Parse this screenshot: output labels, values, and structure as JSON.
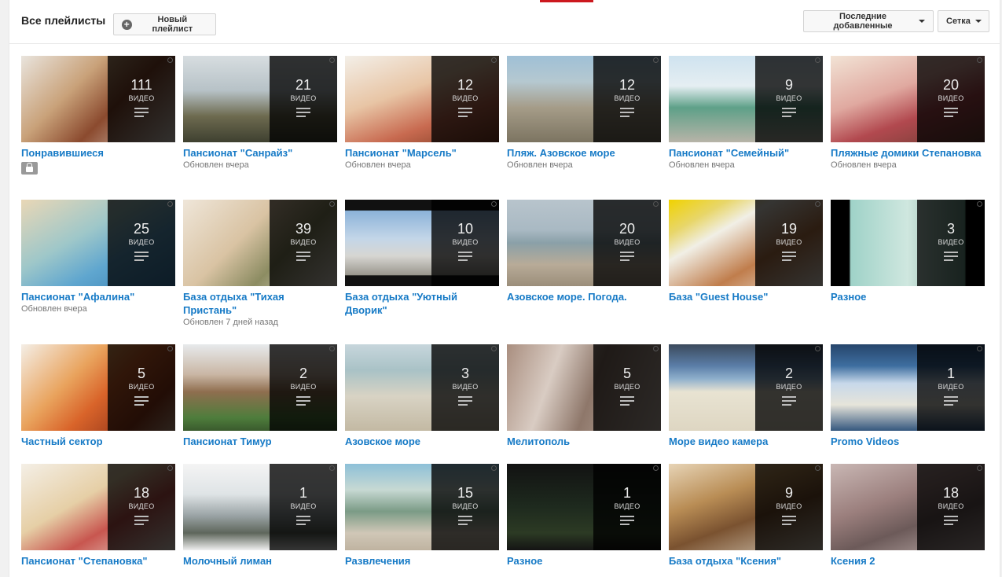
{
  "header": {
    "title": "Все плейлисты",
    "new_playlist_label": "Новый плейлист",
    "sort_label": "Последние добавленные",
    "view_label": "Сетка"
  },
  "count_label": "ВИДЕО",
  "colors": {
    "link": "#167ac6",
    "accent": "#cc181e"
  },
  "playlists": [
    {
      "title": "Понравившиеся",
      "count": "111",
      "meta": "",
      "private": true,
      "bg": "linear-gradient(135deg,#e9e4dd 0%,#c9a27a 35%,#8b4a2e 60%,#e2dcd3 100%)"
    },
    {
      "title": "Пансионат \"Санрайз\"",
      "count": "21",
      "meta": "Обновлен вчера",
      "private": false,
      "bg": "linear-gradient(180deg,#d7dde0 0%,#b7c2c7 40%,#6d6a4f 70%,#3e4030 100%)"
    },
    {
      "title": "Пансионат \"Марсель\"",
      "count": "12",
      "meta": "Обновлен вчера",
      "private": false,
      "bg": "linear-gradient(160deg,#f3efe8 0%,#e8c5a5 40%,#c86a50 70%,#7b3a22 100%)"
    },
    {
      "title": "Пляж. Азовское море",
      "count": "12",
      "meta": "Обновлен вчера",
      "private": false,
      "bg": "linear-gradient(180deg,#9fc0d6 0%,#b5c8d0 30%,#a59c88 60%,#7c7461 100%)"
    },
    {
      "title": "Пансионат \"Семейный\"",
      "count": "9",
      "meta": "Обновлен вчера",
      "private": false,
      "bg": "linear-gradient(180deg,#cfe3ef 0%,#e5eef2 35%,#5ea088 60%,#b8b4a8 100%)"
    },
    {
      "title": "Пляжные домики Степановка",
      "count": "20",
      "meta": "Обновлен вчера",
      "private": false,
      "bg": "linear-gradient(160deg,#f2e3d5 0%,#e0a9a0 40%,#b2494f 65%,#6b3d33 100%)"
    },
    {
      "title": "Пансионат \"Афалина\"",
      "count": "25",
      "meta": "Обновлен вчера",
      "private": false,
      "bg": "linear-gradient(150deg,#e9d7b6 0%,#9ec7c9 40%,#5fa6cf 65%,#3a7fb2 100%)"
    },
    {
      "title": "База отдыха \"Тихая Пристань\"",
      "count": "39",
      "meta": "Обновлен 7 дней назад",
      "private": false,
      "bg": "linear-gradient(135deg,#efe6d9 0%,#d9c3a3 40%,#8c8c62 65%,#e9e2d8 100%)"
    },
    {
      "title": "База отдыха \"Уютный Дворик\"",
      "count": "10",
      "meta": "",
      "private": false,
      "bg": "linear-gradient(180deg,#111 0%,#111 12%,#8cb3d9 13%,#c3d6e8 45%,#d7d6d2 65%,#9a978e 87%,#111 88%,#111 100%)"
    },
    {
      "title": "Азовское море. Погода.",
      "count": "20",
      "meta": "",
      "private": false,
      "bg": "linear-gradient(180deg,#b8c4cc 0%,#a9b9c3 35%,#8aa0a8 50%,#b8ab98 75%,#9b8e7a 100%)"
    },
    {
      "title": "База \"Guest House\"",
      "count": "19",
      "meta": "",
      "private": false,
      "bg": "linear-gradient(150deg,#f0d200 0%,#e8d66a 20%,#f1efe6 35%,#c07d4c 65%,#ede8de 100%)"
    },
    {
      "title": "Разное",
      "count": "3",
      "meta": "",
      "private": false,
      "bg": "linear-gradient(90deg,#000 0%,#000 12%,#9fd2c8 13%,#cfe7df 50%,#6e9d8d 87%,#000 88%,#000 100%)"
    },
    {
      "title": "Частный сектор",
      "count": "5",
      "meta": "",
      "private": false,
      "bg": "linear-gradient(135deg,#f4eee6 0%,#e9a35d 35%,#d9642a 55%,#9b3b1c 80%,#c79d82 100%)"
    },
    {
      "title": "Пансионат Тимур",
      "count": "2",
      "meta": "",
      "private": false,
      "bg": "linear-gradient(180deg,#e7eaec 0%,#c9b6a4 35%,#8f6e4f 55%,#4e7d3c 85%,#3a5a2d 100%)"
    },
    {
      "title": "Азовское море",
      "count": "3",
      "meta": "",
      "private": false,
      "bg": "linear-gradient(180deg,#c7d6dc 0%,#a9c2c6 30%,#d8d3c4 60%,#c3b9a3 100%)"
    },
    {
      "title": "Мелитополь",
      "count": "5",
      "meta": "",
      "private": false,
      "bg": "linear-gradient(110deg,#a98e7f 0%,#d9ccc3 30%,#8e776a 55%,#c8b9ae 100%)"
    },
    {
      "title": "Море видео камера",
      "count": "2",
      "meta": "",
      "private": false,
      "bg": "linear-gradient(180deg,#3b4a5c 0%,#5b7ea8 25%,#8fb0cc 40%,#e8e3d2 55%,#ded6c2 100%)"
    },
    {
      "title": "Promo Videos",
      "count": "1",
      "meta": "",
      "private": false,
      "bg": "linear-gradient(180deg,#26456b 0%,#3e6ea0 25%,#c7d8ea 45%,#e6e4da 70%,#35577e 100%)"
    },
    {
      "title": "Пансионат \"Степановка\"",
      "count": "18",
      "meta": "",
      "private": false,
      "bg": "linear-gradient(150deg,#f4efe6 0%,#e6cfa6 40%,#c8564f 65%,#e9dfd4 100%)"
    },
    {
      "title": "Молочный лиман",
      "count": "1",
      "meta": "",
      "private": false,
      "bg": "linear-gradient(180deg,#f4f4f4 0%,#dfe4e6 35%,#9aa3a5 60%,#5e665b 80%,#efefef 100%)"
    },
    {
      "title": "Развлечения",
      "count": "15",
      "meta": "",
      "private": false,
      "bg": "linear-gradient(180deg,#8dc0d8 0%,#c7d9d3 30%,#7b9b86 55%,#d0c7b7 80%,#bfb3a0 100%)"
    },
    {
      "title": "Разное",
      "count": "1",
      "meta": "",
      "private": false,
      "bg": "linear-gradient(180deg,#121212 0%,#1e2a1e 50%,#2c3a24 80%,#141414 100%)"
    },
    {
      "title": "База отдыха \"Ксения\"",
      "count": "9",
      "meta": "",
      "private": false,
      "bg": "linear-gradient(160deg,#e7d4b6 0%,#b98d55 35%,#7a5230 60%,#d1c5b2 100%)"
    },
    {
      "title": "Ксения 2",
      "count": "18",
      "meta": "",
      "private": false,
      "bg": "linear-gradient(160deg,#c9b7b4 0%,#9b7f7d 40%,#6c5a59 65%,#b9a9a6 100%)"
    }
  ]
}
